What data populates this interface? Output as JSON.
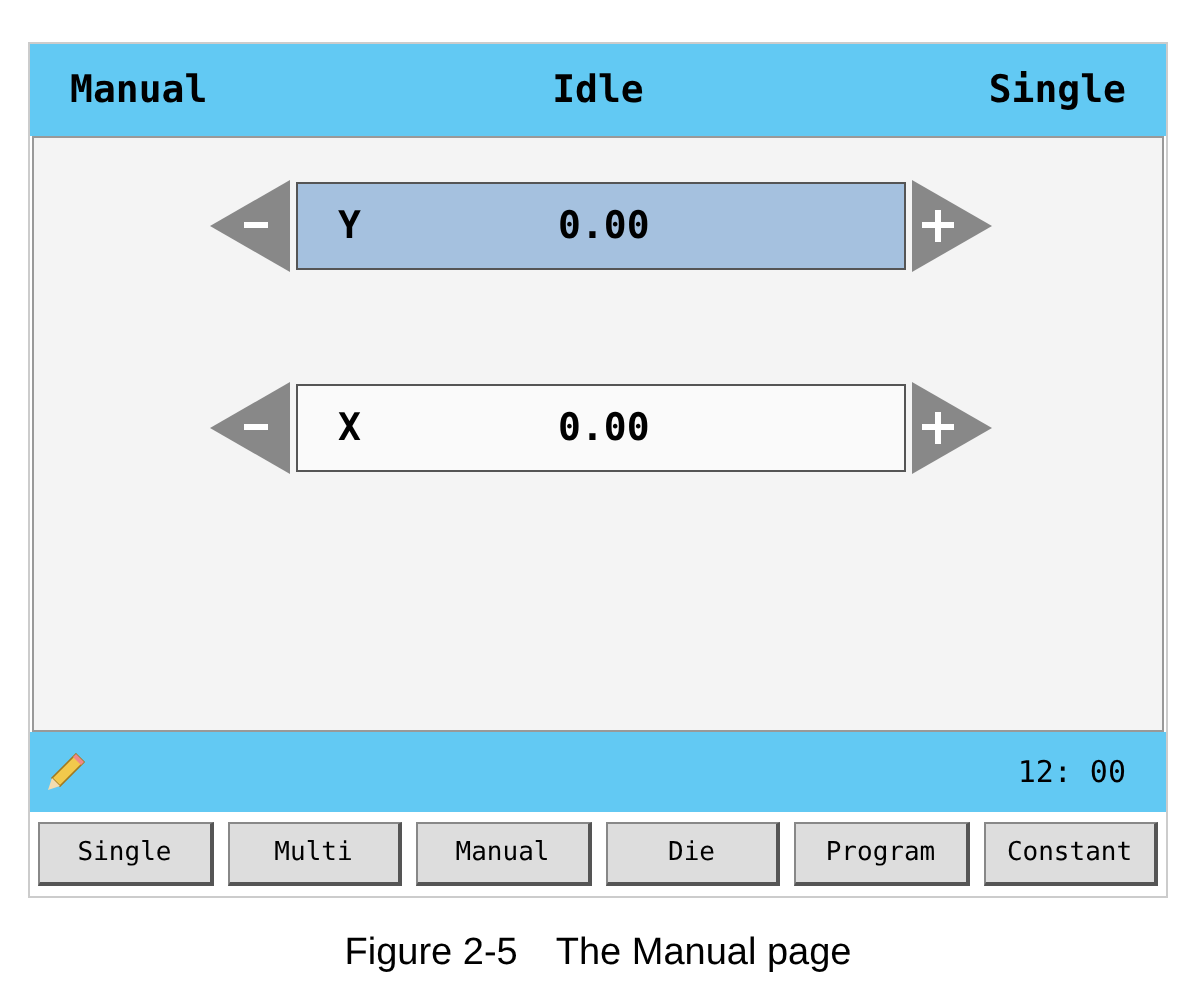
{
  "header": {
    "mode": "Manual",
    "state": "Idle",
    "run_mode": "Single"
  },
  "axes": [
    {
      "name": "Y",
      "value": "0.00",
      "selected": true
    },
    {
      "name": "X",
      "value": "0.00",
      "selected": false
    }
  ],
  "status_bar": {
    "time": "12: 00"
  },
  "buttons": [
    "Single",
    "Multi",
    "Manual",
    "Die",
    "Program",
    "Constant"
  ],
  "caption": "Figure 2-5　The Manual page"
}
